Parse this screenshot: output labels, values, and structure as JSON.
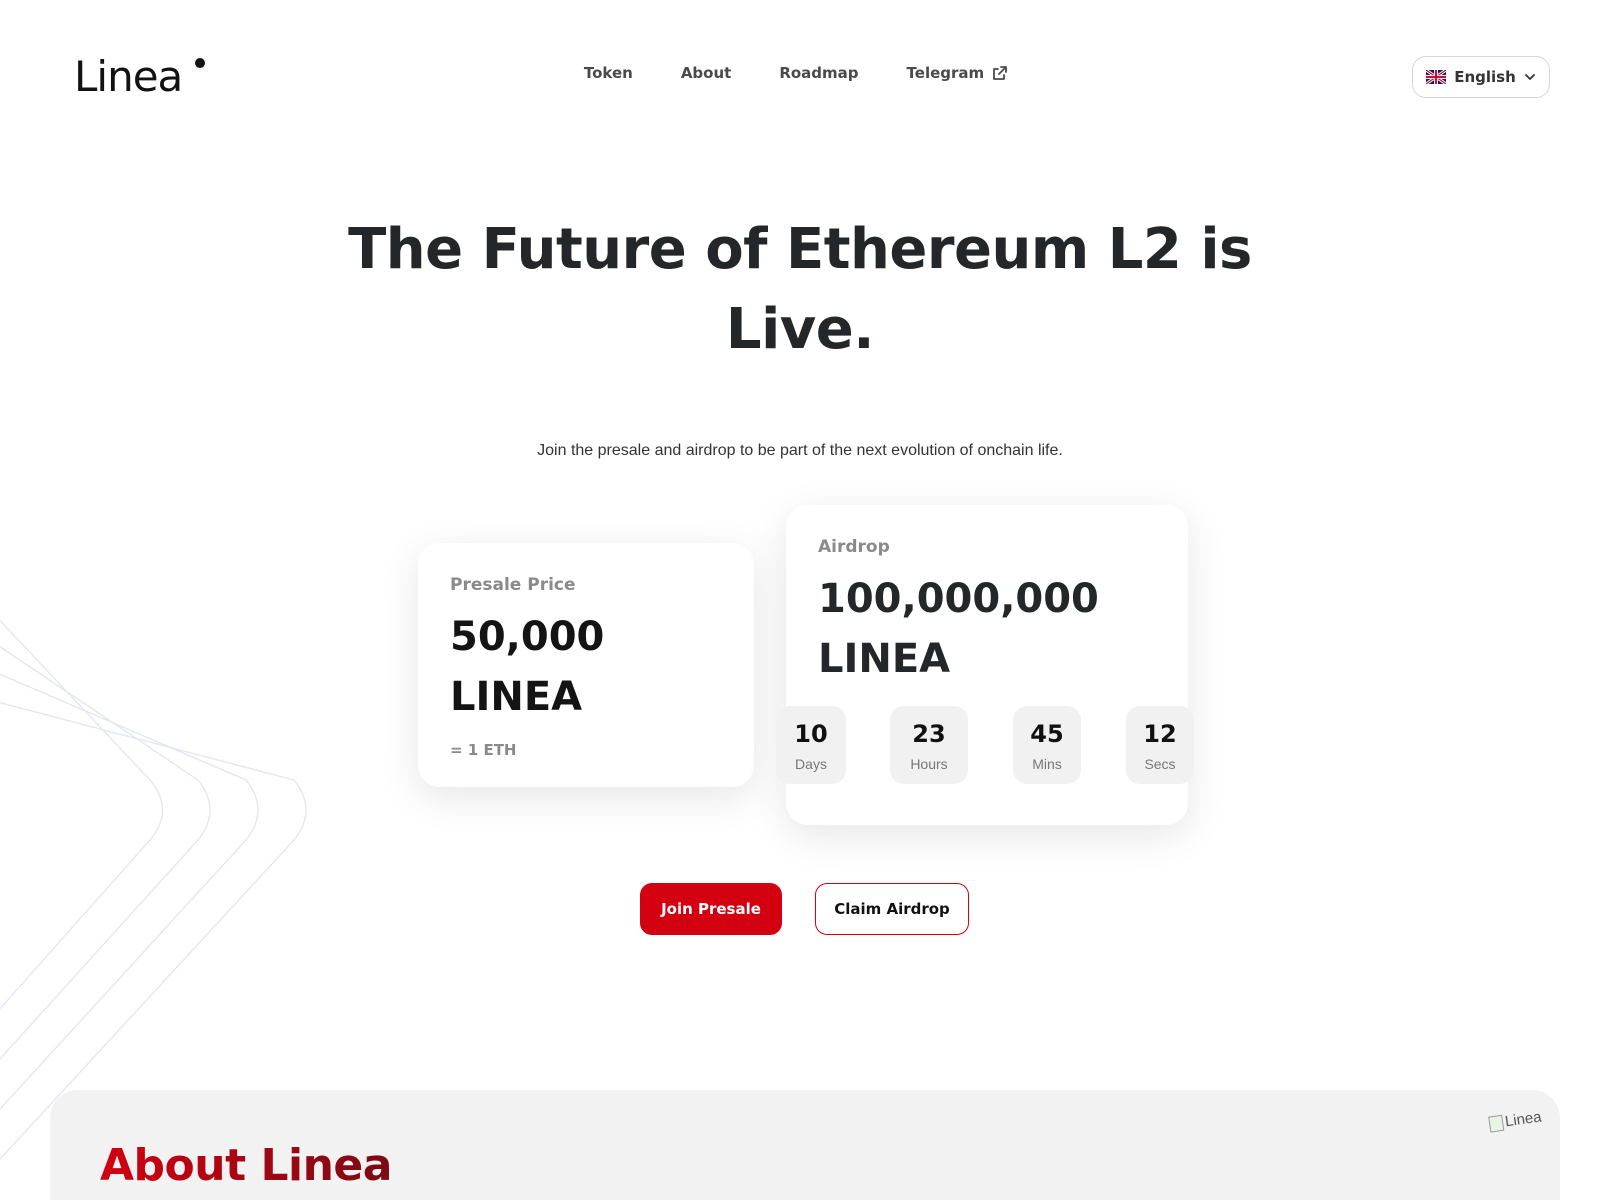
{
  "header": {
    "logo_text": "Linea",
    "nav": [
      {
        "label": "Token"
      },
      {
        "label": "About"
      },
      {
        "label": "Roadmap"
      },
      {
        "label": "Telegram"
      }
    ],
    "language": "English"
  },
  "hero": {
    "title_line1": "The Future of Ethereum L2 is",
    "title_line2": "Live.",
    "subtitle": "Join the presale and airdrop to be part of the next evolution of onchain life."
  },
  "presale": {
    "label": "Presale Price",
    "amount": "50,000",
    "unit": "LINEA",
    "note": "= 1 ETH"
  },
  "airdrop": {
    "label": "Airdrop",
    "amount": "100,000,000",
    "unit": "LINEA"
  },
  "countdown": [
    {
      "value": "10",
      "unit": "Days"
    },
    {
      "value": "23",
      "unit": "Hours"
    },
    {
      "value": "45",
      "unit": "Mins"
    },
    {
      "value": "12",
      "unit": "Secs"
    }
  ],
  "buttons": {
    "join_presale": "Join Presale",
    "claim_airdrop": "Claim Airdrop"
  },
  "about": {
    "title": "About Linea",
    "image_alt": "Linea"
  },
  "colors": {
    "accent": "#d30011",
    "accent_dark": "#7a0b14",
    "text": "#24272a"
  }
}
